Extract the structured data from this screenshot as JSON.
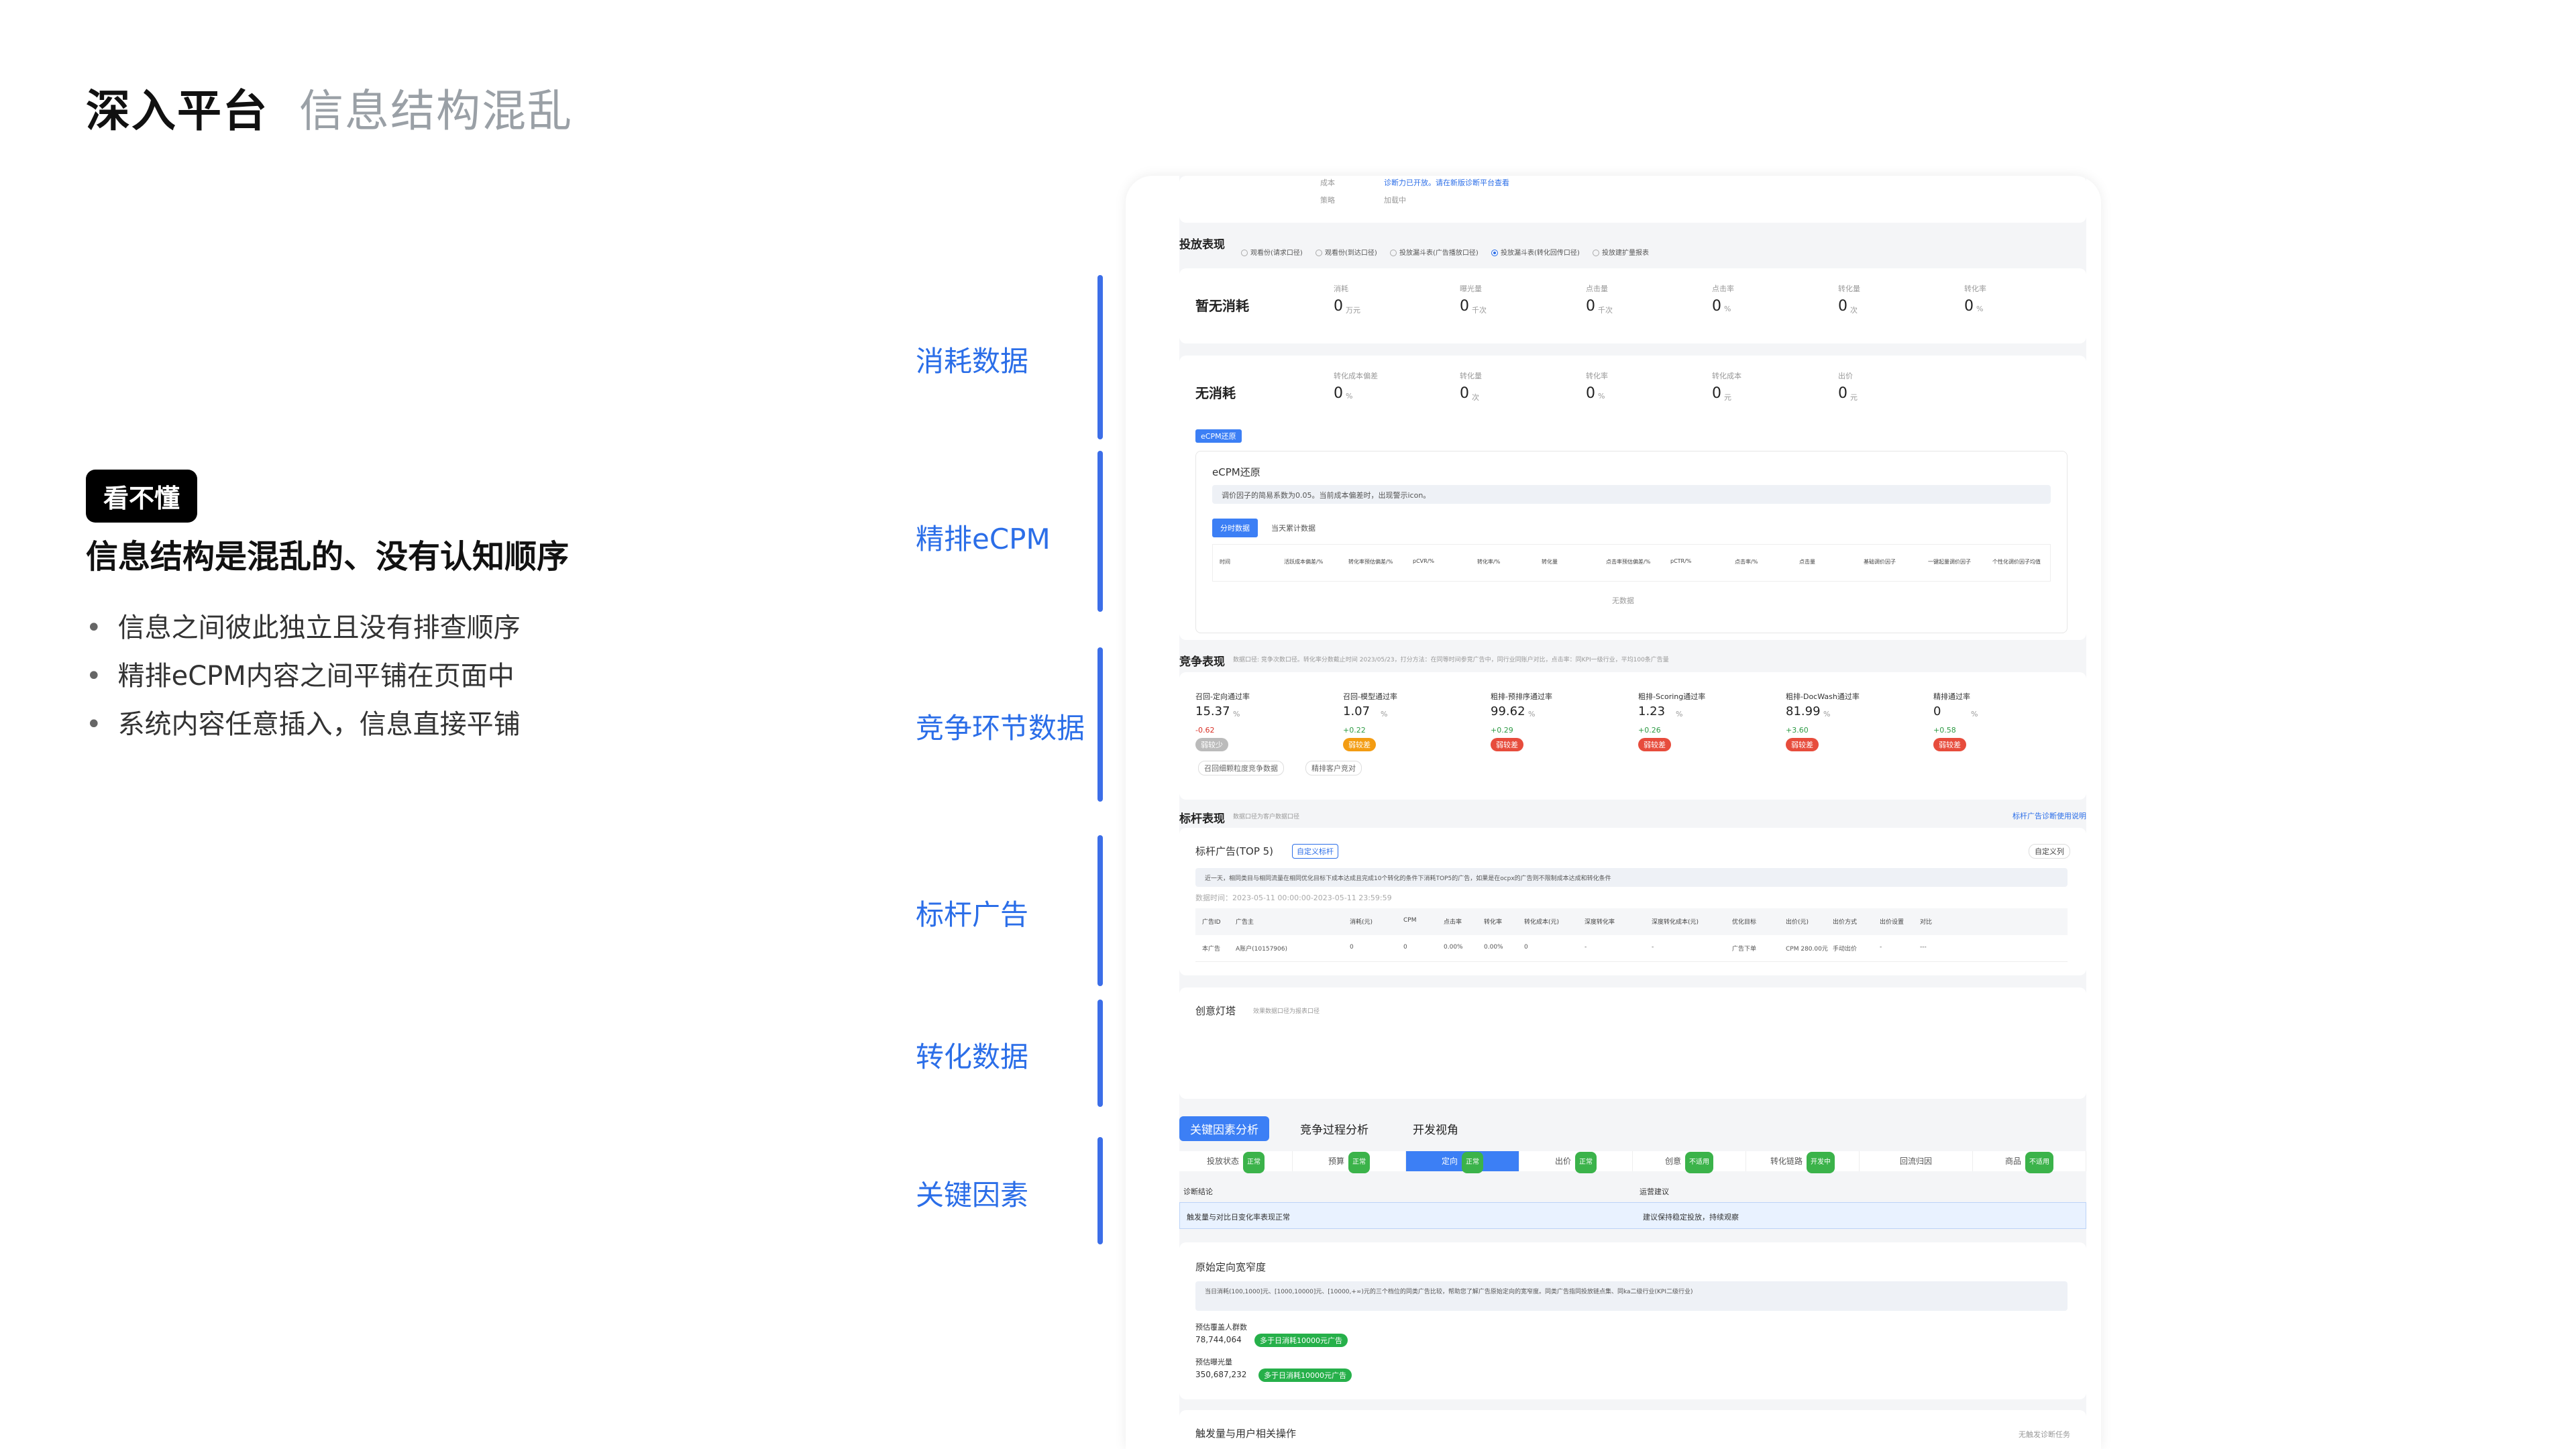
{
  "slide": {
    "title": "深入平台",
    "subtitle": "信息结构混乱",
    "badge": "看不懂",
    "headline": "信息结构是混乱的、没有认知顺序",
    "bullets": [
      "信息之间彼此独立且没有排查顺序",
      "精排eCPM内容之间平铺在页面中",
      "系统内容任意插入，信息直接平铺"
    ],
    "sections": [
      {
        "label": "消耗数据"
      },
      {
        "label": "精排eCPM"
      },
      {
        "label": "竞争环节数据"
      },
      {
        "label": "标杆广告"
      },
      {
        "label": "转化数据"
      },
      {
        "label": "关键因素"
      }
    ],
    "accent_color": "#2b6ee8"
  },
  "screenshot": {
    "top_rows": [
      "成本",
      "策略"
    ],
    "top_status": [
      "诊断力已开放。请在新版诊断平台查看",
      "加载中"
    ],
    "delivery": {
      "title": "投放表现",
      "radios": [
        "观看份(请求口径)",
        "观看份(到达口径)",
        "投放漏斗表(广告播放口径)",
        "投放漏斗表(转化回传口径)",
        "投放建扩量报表"
      ],
      "row1_title": "暂无消耗",
      "row1_metrics": [
        {
          "label": "消耗",
          "value": "0",
          "unit": "万元"
        },
        {
          "label": "曝光量",
          "value": "0",
          "unit": "千次"
        },
        {
          "label": "点击量",
          "value": "0",
          "unit": "千次"
        },
        {
          "label": "点击率",
          "value": "0",
          "unit": "%"
        },
        {
          "label": "转化量",
          "value": "0",
          "unit": "次"
        },
        {
          "label": "转化率",
          "value": "0",
          "unit": "%"
        }
      ],
      "row2_title": "无消耗",
      "row2_metrics": [
        {
          "label": "转化成本偏差",
          "value": "0",
          "unit": "%"
        },
        {
          "label": "转化量",
          "value": "0",
          "unit": "次"
        },
        {
          "label": "转化率",
          "value": "0",
          "unit": "%"
        },
        {
          "label": "转化成本",
          "value": "0",
          "unit": "元"
        },
        {
          "label": "出价",
          "value": "0",
          "unit": "元"
        }
      ],
      "ecpm_toggle": "eCPM还原",
      "ecpm_title": "eCPM还原",
      "ecpm_info": "调价因子的简易系数为0.05。当前成本偏差时，出现警示icon。",
      "ecpm_tabs": [
        "分时数据",
        "当天累计数据"
      ],
      "ecpm_cols": [
        "时间",
        "活跃成本偏差/%",
        "转化率预估偏差/%",
        "pCVR/%",
        "转化率/%",
        "转化量",
        "点击率预估偏差/%",
        "pCTR/%",
        "点击率/%",
        "点击量",
        "基础调价因子",
        "一键起量调价因子",
        "个性化调价因子均值"
      ],
      "ecpm_empty": "无数据"
    },
    "competition": {
      "title": "竞争表现",
      "title_note": "数据口径: 竞争次数口径。转化率分数截止时间 2023/05/23，打分方法：在同等时间参竞广告中，同行业同账户对比，点击率：同KPI一级行业，平均100条广告量",
      "items": [
        {
          "label": "召回-定向通过率",
          "value": "15.37",
          "unit": "%",
          "delta": "-0.62",
          "tag": "弱较少"
        },
        {
          "label": "召回-模型通过率",
          "value": "1.07",
          "unit": "%",
          "delta": "+0.22",
          "tag": "弱较差"
        },
        {
          "label": "粗排-预排序通过率",
          "value": "99.62",
          "unit": "%",
          "delta": "+0.29",
          "tag": "弱较差"
        },
        {
          "label": "粗排-Scoring通过率",
          "value": "1.23",
          "unit": "%",
          "delta": "+0.26",
          "tag": "弱较差"
        },
        {
          "label": "粗排-DocWash通过率",
          "value": "81.99",
          "unit": "%",
          "delta": "+3.60",
          "tag": "弱较差"
        },
        {
          "label": "精排通过率",
          "value": "0",
          "unit": "%",
          "delta": "+0.58",
          "tag": "弱较差"
        }
      ],
      "filters": [
        "召回细颗粒度竞争数据",
        "精排客户竞对"
      ]
    },
    "benchmark": {
      "title": "标杆表现",
      "title_note": "数据口径为客户数据口径",
      "link": "标杆广告诊断使用说明",
      "card_title": "标杆广告(TOP 5)",
      "card_btn": "自定义标杆",
      "card_right_btn": "自定义列",
      "info": "近一天，相同类目与相同流量在相同优化目标下成本达成且完成10个转化的条件下消耗TOP5的广告，如果是在ocpx的广告则不限制成本达成和转化条件",
      "time_range": "数据时间：2023-05-11 00:00:00-2023-05-11 23:59:59",
      "columns": [
        "广告ID",
        "广告主",
        "消耗(元)",
        "CPM",
        "点击率",
        "转化率",
        "转化成本(元)",
        "深度转化率",
        "深度转化成本(元)",
        "优化目标",
        "出价(元)",
        "出价方式",
        "出价设置",
        "对比"
      ],
      "row": [
        "本广告",
        "A账户(10157906)",
        "0",
        "0",
        "0.00%",
        "0.00%",
        "0",
        "-",
        "-",
        "广告下单",
        "CPM 280.00元",
        "手动出价",
        "-",
        "---"
      ]
    },
    "creative": {
      "title": "创意灯塔",
      "note": "效果数据口径为报表口径"
    },
    "tabs": [
      "关键因素分析",
      "竞争过程分析",
      "开发视角"
    ],
    "subtabs": [
      {
        "label": "投放状态",
        "tag": "正常"
      },
      {
        "label": "预算",
        "tag": "正常"
      },
      {
        "label": "定向",
        "tag": "正常"
      },
      {
        "label": "出价",
        "tag": "正常"
      },
      {
        "label": "创意",
        "tag": "不适用"
      },
      {
        "label": "转化链路",
        "tag": "开发中"
      },
      {
        "label": "回流归因",
        "tag": ""
      },
      {
        "label": "商品",
        "tag": "不适用"
      }
    ],
    "diagnosis": {
      "left_h": "诊断结论",
      "right_h": "运营建议",
      "left_text": "触发量与对比日变化率表现正常",
      "right_text": "建议保持稳定投放，持续观察"
    },
    "targeting": {
      "title": "原始定向宽窄度",
      "info": "当日消耗(100,1000]元、[1000,10000]元、[10000,+∞)元的三个档位的同类广告比较，帮助您了解广告原始定向的宽窄度。同类广告指同投放链点集、同ka二级行业(KPI二级行业)",
      "label1": "预估覆盖人群数",
      "value1": "78,744,064",
      "tag1": "多于日消耗10000元广告",
      "label2": "预估曝光量",
      "value2": "350,687,232",
      "tag2": "多于日消耗10000元广告"
    },
    "footer": {
      "title": "触发量与用户相关操作",
      "right": "无触发诊断任务"
    }
  }
}
